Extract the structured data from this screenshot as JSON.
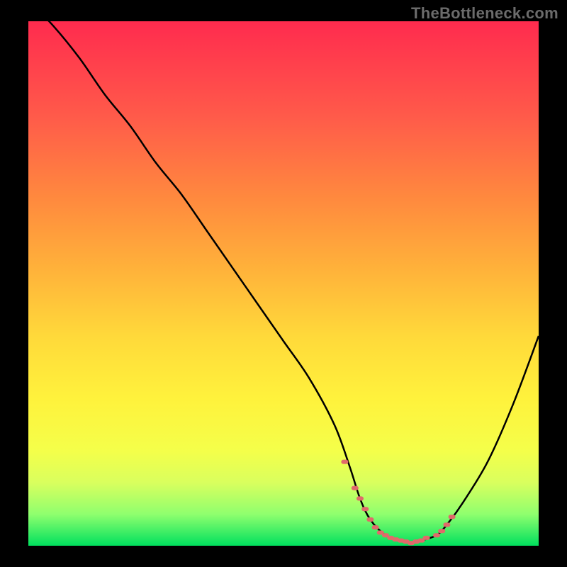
{
  "watermark": "TheBottleneck.com",
  "colors": {
    "background": "#000000",
    "gradient_top": "#ff2b4e",
    "gradient_bottom": "#00e05e",
    "curve_stroke": "#000000",
    "marker_fill": "#e06a6a"
  },
  "chart_data": {
    "type": "line",
    "title": "",
    "xlabel": "",
    "ylabel": "",
    "ylim": [
      0,
      100
    ],
    "xlim": [
      0,
      100
    ],
    "series": [
      {
        "name": "bottleneck-curve",
        "x": [
          0,
          5,
          10,
          15,
          20,
          25,
          30,
          35,
          40,
          45,
          50,
          55,
          60,
          63,
          65,
          67,
          70,
          73,
          75,
          77,
          80,
          82,
          85,
          90,
          95,
          100
        ],
        "values": [
          104,
          99,
          93,
          86,
          80,
          73,
          67,
          60,
          53,
          46,
          39,
          32,
          23,
          15,
          9,
          5,
          2,
          1,
          0.5,
          1,
          2,
          4,
          8,
          16,
          27,
          40
        ]
      }
    ],
    "markers": {
      "name": "optimum-zone",
      "x": [
        62,
        64,
        65,
        66,
        67,
        68,
        69,
        70,
        71,
        72,
        73,
        74,
        75,
        76,
        77,
        78,
        80,
        81,
        82,
        83
      ],
      "values": [
        16,
        11,
        9,
        7,
        5,
        3.5,
        2.5,
        2,
        1.5,
        1.2,
        1,
        0.8,
        0.5,
        0.8,
        1,
        1.5,
        2,
        2.8,
        4,
        5.5
      ]
    },
    "annotations": []
  }
}
